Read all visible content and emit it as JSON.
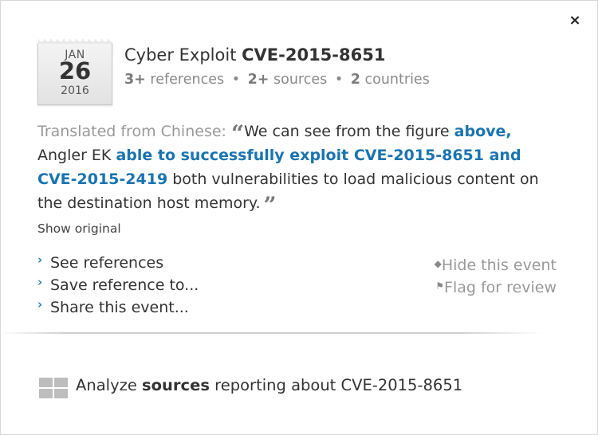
{
  "close": {
    "glyph": "×"
  },
  "calendar": {
    "month": "JAN",
    "day": "26",
    "year": "2016"
  },
  "header": {
    "title_prefix": "Cyber Exploit",
    "title_cve": "CVE-2015-8651",
    "references_count": "3+",
    "references_label": "references",
    "sources_count": "2+",
    "sources_label": "sources",
    "countries_count": "2",
    "countries_label": "countries",
    "separator": "•"
  },
  "quote": {
    "translated_label": "Translated from Chinese:",
    "text1": "We can see from the figure",
    "link1": "above,",
    "text2": "Angler EK",
    "link2": "able to successfully exploit CVE-2015-8651 and CVE-2015-2419",
    "text3": "both vulnerabilities to load malicious content on the destination host memory."
  },
  "show_original": "Show original",
  "actions": {
    "see_references": "See references",
    "save_reference": "Save reference to...",
    "share_event": "Share this event..."
  },
  "right_actions": {
    "hide_event": "Hide this event",
    "flag_review": "Flag for review"
  },
  "analyze": {
    "prefix": "Analyze",
    "bold": "sources",
    "suffix": "reporting about CVE-2015-8651"
  }
}
